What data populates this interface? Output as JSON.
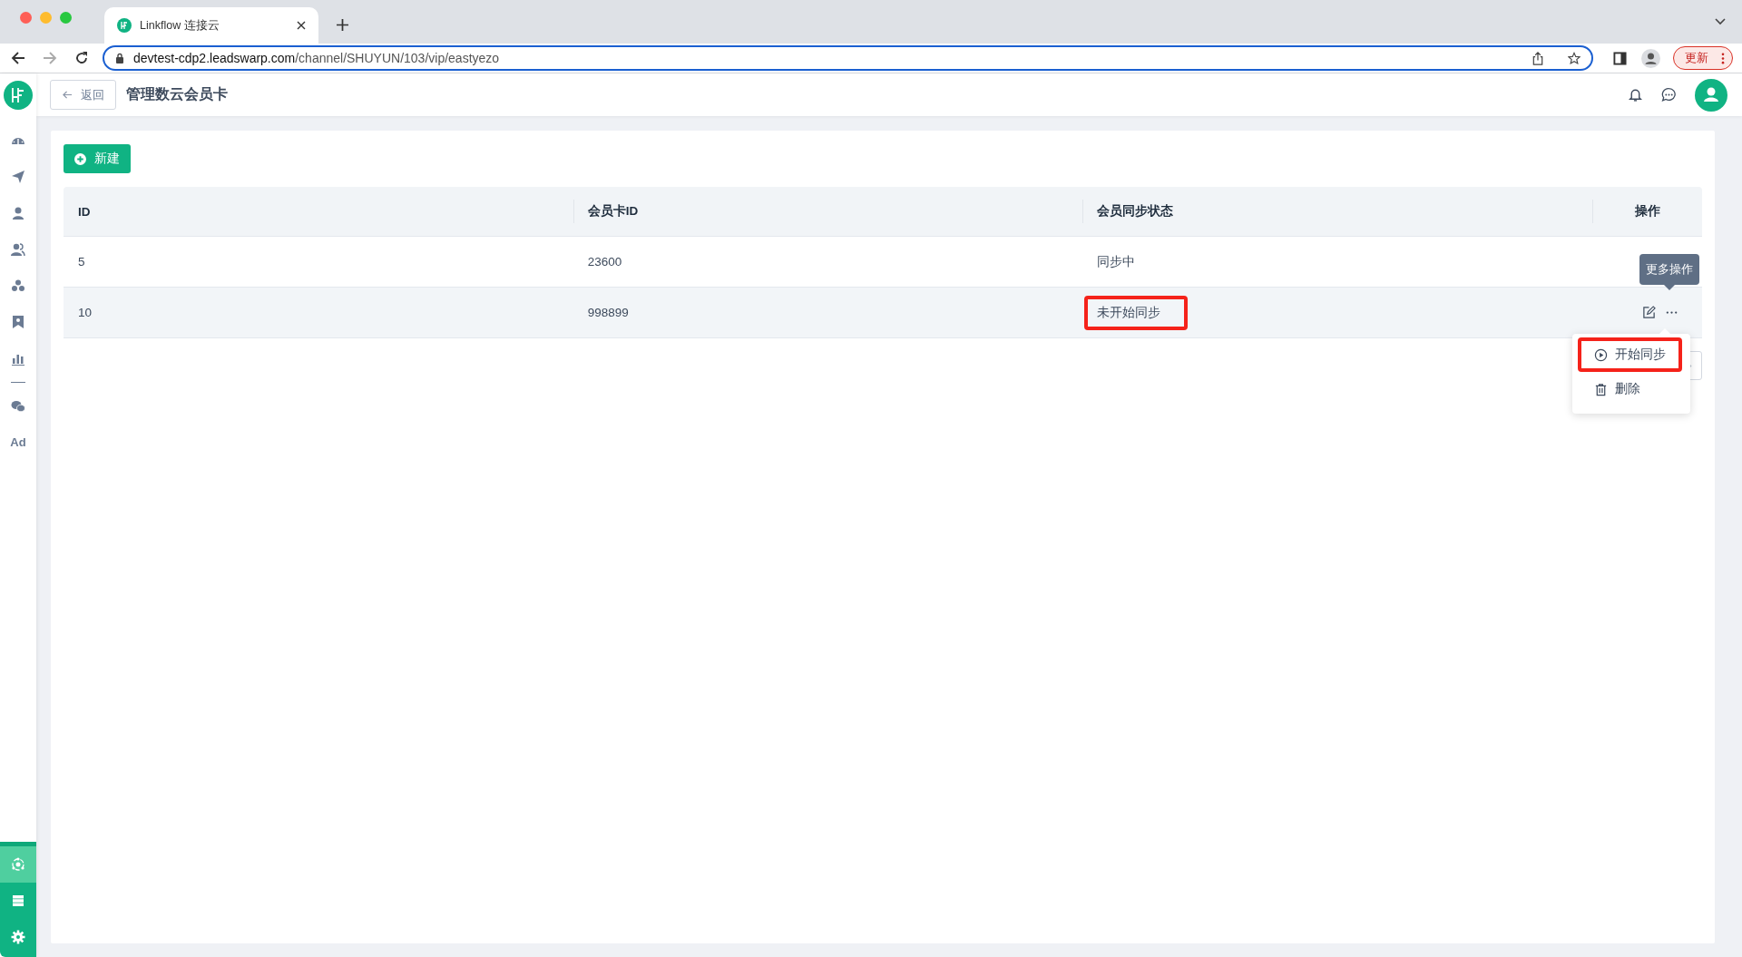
{
  "browser": {
    "tab_title": "Linkflow 连接云",
    "url_host": "devtest-cdp2.leadswarp.com",
    "url_path": "/channel/SHUYUN/103/vip/eastyezo",
    "update_button": "更新"
  },
  "sidebar": {
    "items": [
      {
        "kind": "dashboard"
      },
      {
        "kind": "send"
      },
      {
        "kind": "user"
      },
      {
        "kind": "users"
      },
      {
        "kind": "groups"
      },
      {
        "kind": "badge"
      },
      {
        "kind": "chart"
      },
      {
        "kind": "divider"
      },
      {
        "kind": "wechat"
      },
      {
        "kind": "text",
        "label": "Ad"
      }
    ],
    "bottom_items": [
      {
        "kind": "hub",
        "selected": true
      },
      {
        "kind": "server",
        "selected": false
      },
      {
        "kind": "settings",
        "selected": false
      }
    ]
  },
  "header": {
    "back_button": "返回",
    "title": "管理数云会员卡"
  },
  "new_button": "新建",
  "table": {
    "columns": [
      "ID",
      "会员卡ID",
      "会员同步状态",
      "操作"
    ],
    "rows": [
      {
        "id": "5",
        "card_id": "23600",
        "status": "同步中",
        "hovered": false,
        "highlighted": false
      },
      {
        "id": "10",
        "card_id": "998899",
        "status": "未开始同步",
        "hovered": true,
        "highlighted": true
      }
    ]
  },
  "tooltip": "更多操作",
  "menu": [
    {
      "kind": "play",
      "label": "开始同步",
      "highlighted": true
    },
    {
      "kind": "delete",
      "label": "删除",
      "highlighted": false
    }
  ]
}
